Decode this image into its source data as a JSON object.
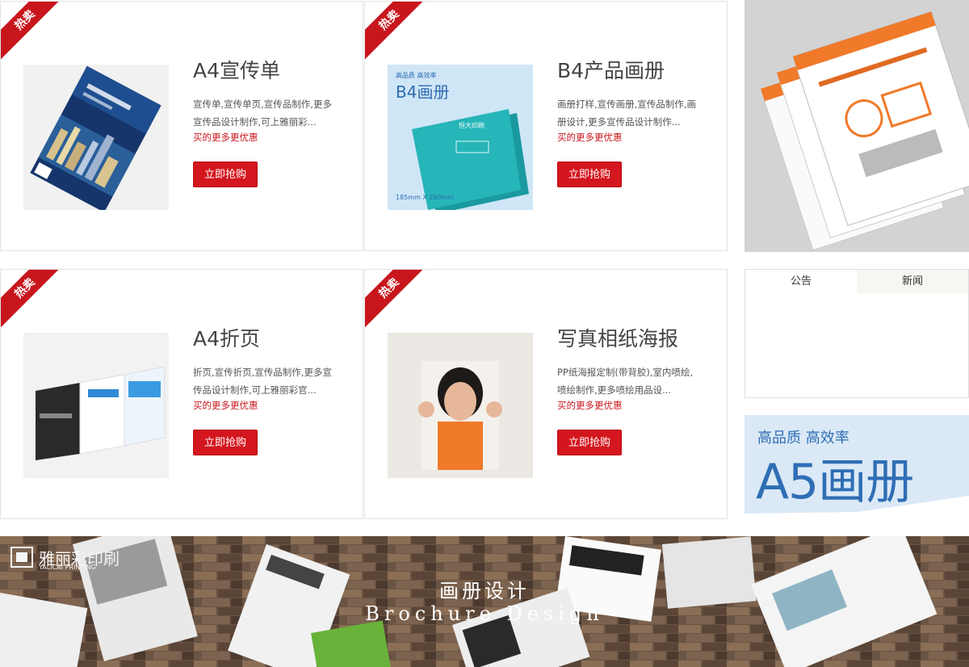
{
  "badge": "热卖",
  "buy_label": "立即抢购",
  "promo": "买的更多更优惠",
  "products": [
    {
      "title": "A4宣传单",
      "desc": "宣传单,宣传单页,宣传品制作,更多宣传品设计制作,可上雅丽彩..."
    },
    {
      "title": "B4产品画册",
      "desc": "画册打样,宣传画册,宣传品制作,画册设计,更多宣传品设计制作..."
    },
    {
      "title": "A4折页",
      "desc": "折页,宣传折页,宣传品制作,更多宣传品设计制作,可上雅丽彩官..."
    },
    {
      "title": "写真相纸海报",
      "desc": "PP纸海报定制(带背胶),室内喷绘,喷绘制作,更多喷绘用品设..."
    }
  ],
  "b4_image": {
    "tag": "高品质 高效率",
    "title": "B4画册",
    "size": "185mm X 260mm"
  },
  "notice_tabs": [
    "公告",
    "新闻"
  ],
  "a5_promo": {
    "tag": "高品质 高效率",
    "title": "A5画册"
  },
  "banner": {
    "logo_cn": "雅丽彩印刷",
    "logo_en": "YALICAI PRINTING",
    "title_cn": "画册设计",
    "title_en": "Brochure Design"
  },
  "colors": {
    "accent": "#c8161d",
    "button": "#d4161e",
    "a5_blue": "#2f6eb5"
  }
}
